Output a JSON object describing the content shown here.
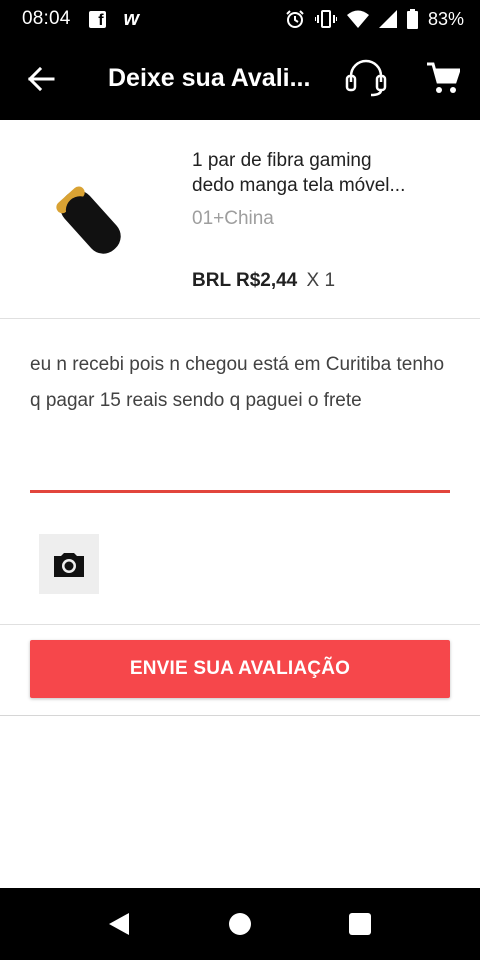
{
  "status_bar": {
    "time": "08:04",
    "battery_percent": "83%",
    "icons": [
      "facebook-icon",
      "wish-icon",
      "alarm-icon",
      "vibrate-icon",
      "wifi-icon",
      "signal-icon",
      "battery-icon"
    ]
  },
  "app_bar": {
    "title": "Deixe sua Avali...",
    "back_icon": "arrow-back-icon",
    "support_icon": "headset-icon",
    "cart_icon": "cart-icon"
  },
  "product": {
    "name_line1": "1 par de fibra gaming",
    "name_line2": "dedo manga tela móvel...",
    "variant": "01+China",
    "price": "BRL R$2,44",
    "quantity": "X 1"
  },
  "review": {
    "text": "eu n recebi pois n chegou está em Curitiba tenho q pagar 15 reais sendo q paguei o frete",
    "accent_color": "#e2453c",
    "camera_icon": "camera-icon"
  },
  "submit": {
    "label": "ENVIE SUA AVALIAÇÃO",
    "color": "#f6474b"
  },
  "nav_bar": {
    "icons": [
      "nav-back-icon",
      "nav-home-icon",
      "nav-recents-icon"
    ]
  }
}
